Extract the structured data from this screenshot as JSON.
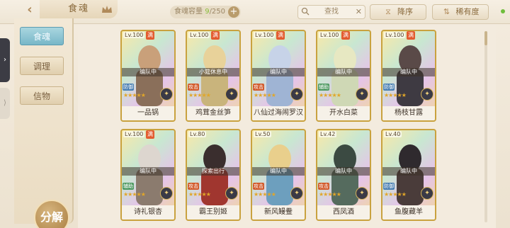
{
  "header": {
    "back_icon": "back-arrow-icon",
    "title": "食魂",
    "capacity_label": "食魂容量",
    "capacity_current": "9",
    "capacity_max": "/250",
    "search_placeholder": "查找",
    "sort_order_label": "降序",
    "sort_rarity_label": "稀有度"
  },
  "sidebar": {
    "tabs": [
      {
        "label": "食魂"
      },
      {
        "label": "调理"
      },
      {
        "label": "信物"
      }
    ],
    "decompose_label": "分解"
  },
  "cards": [
    {
      "level": "Lv.100",
      "full": "满",
      "status": "编队中",
      "role": "防御",
      "name": "一品锅"
    },
    {
      "level": "Lv.100",
      "full": "满",
      "status": "小筵休息中",
      "role": "攻击",
      "name": "鸡茸金丝笋"
    },
    {
      "level": "Lv.100",
      "full": "满",
      "status": "编队中",
      "role": "攻击",
      "name": "八仙过海闹罗汉"
    },
    {
      "level": "Lv.100",
      "full": "满",
      "status": "编队中",
      "role": "辅助",
      "name": "开水白菜"
    },
    {
      "level": "Lv.100",
      "full": "满",
      "status": "编队中",
      "role": "防御",
      "name": "杨枝甘露"
    },
    {
      "level": "Lv.100",
      "full": "满",
      "status": "编队中",
      "role": "辅助",
      "name": "诗礼银杏"
    },
    {
      "level": "Lv.80",
      "full": "",
      "status": "探索出行",
      "role": "攻击",
      "name": "霸王别姬"
    },
    {
      "level": "Lv.50",
      "full": "",
      "status": "编队中",
      "role": "攻击",
      "name": "新风鳗鲞"
    },
    {
      "level": "Lv.42",
      "full": "",
      "status": "编队中",
      "role": "攻击",
      "name": "西凤酒"
    },
    {
      "level": "Lv.40",
      "full": "",
      "status": "编队中",
      "role": "防御",
      "name": "鱼腹藏羊"
    }
  ]
}
